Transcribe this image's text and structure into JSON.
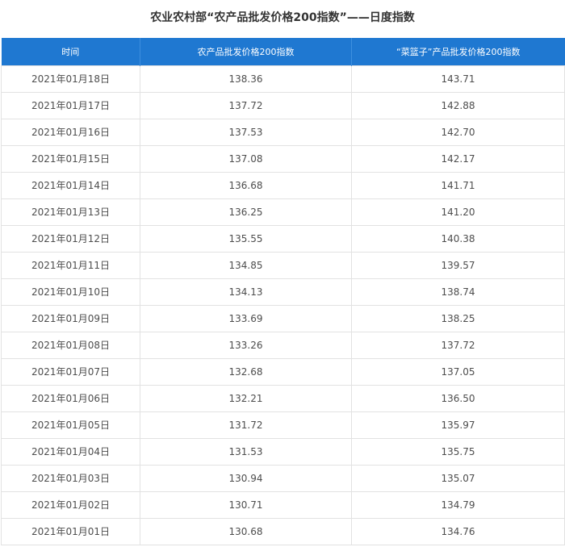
{
  "title": "农业农村部“农产品批发价格200指数”——日度指数",
  "columns": [
    "时间",
    "农产品批发价格200指数",
    "“菜篮子”产品批发价格200指数"
  ],
  "rows": [
    {
      "date": "2021年01月18日",
      "index200": "138.36",
      "basket200": "143.71"
    },
    {
      "date": "2021年01月17日",
      "index200": "137.72",
      "basket200": "142.88"
    },
    {
      "date": "2021年01月16日",
      "index200": "137.53",
      "basket200": "142.70"
    },
    {
      "date": "2021年01月15日",
      "index200": "137.08",
      "basket200": "142.17"
    },
    {
      "date": "2021年01月14日",
      "index200": "136.68",
      "basket200": "141.71"
    },
    {
      "date": "2021年01月13日",
      "index200": "136.25",
      "basket200": "141.20"
    },
    {
      "date": "2021年01月12日",
      "index200": "135.55",
      "basket200": "140.38"
    },
    {
      "date": "2021年01月11日",
      "index200": "134.85",
      "basket200": "139.57"
    },
    {
      "date": "2021年01月10日",
      "index200": "134.13",
      "basket200": "138.74"
    },
    {
      "date": "2021年01月09日",
      "index200": "133.69",
      "basket200": "138.25"
    },
    {
      "date": "2021年01月08日",
      "index200": "133.26",
      "basket200": "137.72"
    },
    {
      "date": "2021年01月07日",
      "index200": "132.68",
      "basket200": "137.05"
    },
    {
      "date": "2021年01月06日",
      "index200": "132.21",
      "basket200": "136.50"
    },
    {
      "date": "2021年01月05日",
      "index200": "131.72",
      "basket200": "135.97"
    },
    {
      "date": "2021年01月04日",
      "index200": "131.53",
      "basket200": "135.75"
    },
    {
      "date": "2021年01月03日",
      "index200": "130.94",
      "basket200": "135.07"
    },
    {
      "date": "2021年01月02日",
      "index200": "130.71",
      "basket200": "134.79"
    },
    {
      "date": "2021年01月01日",
      "index200": "130.68",
      "basket200": "134.76"
    }
  ],
  "colors": {
    "header_bg": "#1f78d1",
    "header_text": "#ffffff",
    "border": "#e2e2e2"
  }
}
